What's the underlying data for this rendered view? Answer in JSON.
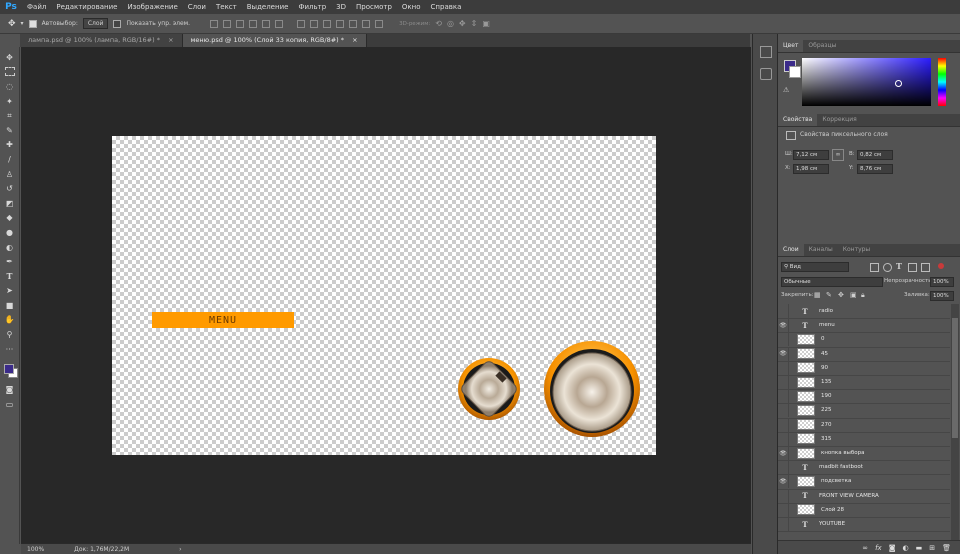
{
  "app": {
    "logo": "Ps"
  },
  "menu": [
    "Файл",
    "Редактирование",
    "Изображение",
    "Слои",
    "Текст",
    "Выделение",
    "Фильтр",
    "3D",
    "Просмотр",
    "Окно",
    "Справка"
  ],
  "options": {
    "autoselect_label": "Автовыбор:",
    "autoselect_value": "Слой",
    "show_controls_label": "Показать упр. элем.",
    "mode_3d": "3D-режим:"
  },
  "tabs": [
    {
      "label": "лампа.psd @ 100% (лампа, RGB/16#) *",
      "active": false
    },
    {
      "label": "меню.psd @ 100% (Слой 33 копия, RGB/8#) *",
      "active": true
    }
  ],
  "canvas": {
    "menu_text": "MENU"
  },
  "status": {
    "zoom": "100%",
    "doc": "Док: 1,76M/22,2M"
  },
  "color_panel": {
    "tabs": [
      "Цвет",
      "Образцы"
    ],
    "foreground": "#3b2b8a",
    "background": "#ffffff"
  },
  "properties_panel": {
    "tabs": [
      "Свойства",
      "Коррекция"
    ],
    "title": "Свойства пиксельного слоя",
    "w_label": "Ш:",
    "w_value": "7,12 см",
    "h_label": "В:",
    "h_value": "0,82 см",
    "x_label": "X:",
    "x_value": "1,98 см",
    "y_label": "Y:",
    "y_value": "8,76 см"
  },
  "layers_panel": {
    "tabs": [
      "Слои",
      "Каналы",
      "Контуры"
    ],
    "filter_value": "Вид",
    "blend_mode": "Обычные",
    "opacity_label": "Непрозрачность:",
    "opacity_value": "100%",
    "lock_label": "Закрепить:",
    "fill_label": "Заливка:",
    "fill_value": "100%",
    "layers": [
      {
        "name": "radio",
        "type": "text",
        "visible": false
      },
      {
        "name": "menu",
        "type": "text",
        "visible": true
      },
      {
        "name": "0",
        "type": "pixel",
        "visible": false
      },
      {
        "name": "45",
        "type": "pixel",
        "visible": true
      },
      {
        "name": "90",
        "type": "pixel",
        "visible": false
      },
      {
        "name": "135",
        "type": "pixel",
        "visible": false
      },
      {
        "name": "190",
        "type": "pixel",
        "visible": false
      },
      {
        "name": "225",
        "type": "pixel",
        "visible": false
      },
      {
        "name": "270",
        "type": "pixel",
        "visible": false
      },
      {
        "name": "315",
        "type": "pixel",
        "visible": false
      },
      {
        "name": "кнопка выбора",
        "type": "pixel",
        "visible": true
      },
      {
        "name": "madbit fastboot",
        "type": "text",
        "visible": false
      },
      {
        "name": "подсветка",
        "type": "pixel",
        "visible": true
      },
      {
        "name": "FRONT VIEW CAMERA",
        "type": "text",
        "visible": false
      },
      {
        "name": "Слой 28",
        "type": "pixel",
        "visible": false
      },
      {
        "name": "YOUTUBE",
        "type": "text",
        "visible": false
      }
    ]
  }
}
